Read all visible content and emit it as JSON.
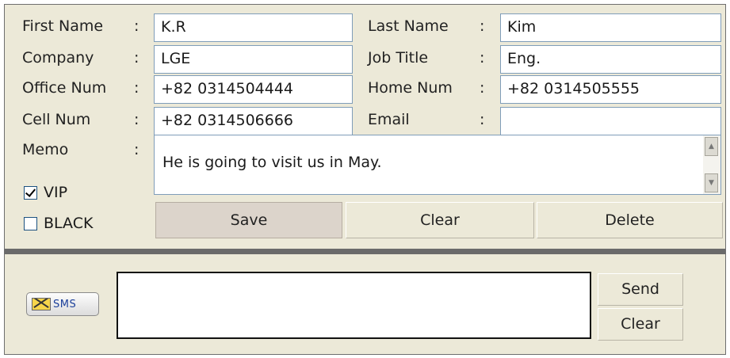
{
  "form": {
    "first_name_label": "First Name",
    "first_name_value": "K.R",
    "last_name_label": "Last Name",
    "last_name_value": "Kim",
    "company_label": "Company",
    "company_value": "LGE",
    "job_title_label": "Job Title",
    "job_title_value": "Eng.",
    "office_num_label": "Office Num",
    "office_num_value": "+82 0314504444",
    "home_num_label": "Home Num",
    "home_num_value": "+82 0314505555",
    "cell_num_label": "Cell Num",
    "cell_num_value": "+82 0314506666",
    "email_label": "Email",
    "email_value": "",
    "memo_label": "Memo",
    "memo_value": "He is going to visit us in May.",
    "colon": ":"
  },
  "flags": {
    "vip_label": "VIP",
    "vip_checked": true,
    "black_label": "BLACK",
    "black_checked": false
  },
  "actions": {
    "save_label": "Save",
    "clear_label": "Clear",
    "delete_label": "Delete"
  },
  "sms": {
    "button_label": "SMS",
    "message_value": "",
    "send_label": "Send",
    "clear_label": "Clear"
  },
  "colors": {
    "panel_bg": "#ece9d8",
    "field_border": "#7f9db9",
    "divider": "#6a6a6a",
    "save_bg": "#dcd4cb"
  },
  "icons": {
    "sms_icon": "envelope-icon",
    "scroll_up": "arrow-up-icon",
    "scroll_down": "arrow-down-icon"
  }
}
